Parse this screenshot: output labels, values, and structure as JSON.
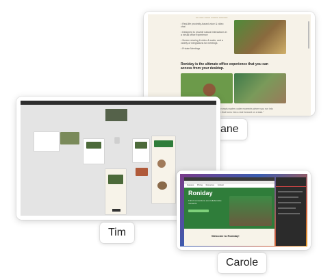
{
  "participants": [
    {
      "name": "Jane"
    },
    {
      "name": "Tim"
    },
    {
      "name": "Carole"
    }
  ],
  "jane_screen": {
    "bullets": [
      "Real-life proximity-based voice & video chat",
      "Designed to provide natural interactions in a virtual office experience",
      "Screen sharing & video & audio, and a variety of integrations for meetings",
      "Private Meetings"
    ],
    "headline": "Roniday is the ultimate office experience that you can access from your desktop.",
    "quote": "\"The space really promotes those impromptu water cooler moments where you run into someone and spark up a conversation that turns into a real forward on a task.\""
  },
  "carole_screen": {
    "hero_logo": "Roniday",
    "hero_sub": "Full of connections and collaborative moments",
    "welcome": "Welcome to Roniday!",
    "nav_items": [
      "Features",
      "Pricing",
      "Resources",
      "Contact"
    ]
  },
  "colors": {
    "cream": "#f6f2e8",
    "canvas_gray": "#e4e4e4",
    "hero_green": "#2f7d3a"
  }
}
